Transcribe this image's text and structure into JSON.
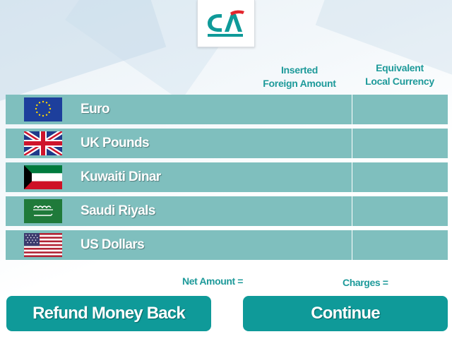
{
  "logo": {
    "name": "credit-agricole-logo",
    "brand_color": "#0f9a99",
    "accent_color": "#e3262d"
  },
  "table": {
    "headers": {
      "inserted_line1": "Inserted",
      "inserted_line2": "Foreign Amount",
      "equivalent_line1": "Equivalent",
      "equivalent_line2": "Local Currency"
    },
    "rows": [
      {
        "label": "Euro",
        "flag": "eu-flag-icon"
      },
      {
        "label": "UK Pounds",
        "flag": "uk-flag-icon"
      },
      {
        "label": "Kuwaiti Dinar",
        "flag": "kuwait-flag-icon"
      },
      {
        "label": "Saudi Riyals",
        "flag": "saudi-flag-icon"
      },
      {
        "label": "US Dollars",
        "flag": "us-flag-icon"
      }
    ],
    "row_color": "#7fbfbe"
  },
  "summary": {
    "net_amount_label": "Net Amount =",
    "charges_label": "Charges ="
  },
  "buttons": {
    "refund_label": "Refund Money Back",
    "continue_label": "Continue",
    "color": "#0f9a99"
  }
}
